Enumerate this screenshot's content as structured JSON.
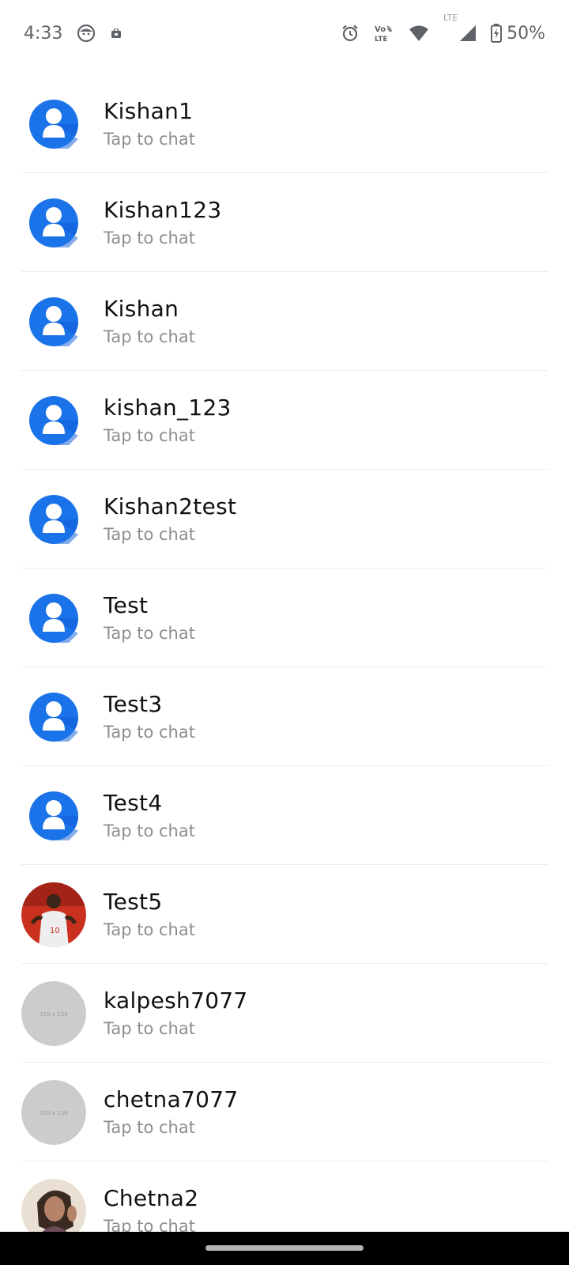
{
  "status_bar": {
    "time": "4:33",
    "battery": "50%",
    "left_icons": [
      "face-icon",
      "notification-icon"
    ],
    "right_icons": [
      "alarm-icon",
      "volte-icon",
      "wifi-icon",
      "lte-icon",
      "signal-icon",
      "battery-icon"
    ],
    "volte_label_top": "Vo",
    "volte_label_bottom": "LTE",
    "lte_label": "LTE"
  },
  "colors": {
    "default_avatar": "#1a73e8",
    "placeholder_avatar": "#cccccc",
    "subtitle": "#8e8e8e",
    "divider": "#ececec"
  },
  "chats": [
    {
      "name": "Kishan1",
      "subtitle": "Tap to chat",
      "avatar": "default-person-icon"
    },
    {
      "name": "Kishan123",
      "subtitle": "Tap to chat",
      "avatar": "default-person-icon"
    },
    {
      "name": "Kishan",
      "subtitle": "Tap to chat",
      "avatar": "default-person-icon"
    },
    {
      "name": "kishan_123",
      "subtitle": "Tap to chat",
      "avatar": "default-person-icon"
    },
    {
      "name": "Kishan2test",
      "subtitle": "Tap to chat",
      "avatar": "default-person-icon"
    },
    {
      "name": "Test",
      "subtitle": "Tap to chat",
      "avatar": "default-person-icon"
    },
    {
      "name": "Test3",
      "subtitle": "Tap to chat",
      "avatar": "default-person-icon"
    },
    {
      "name": "Test4",
      "subtitle": "Tap to chat",
      "avatar": "default-person-icon"
    },
    {
      "name": "Test5",
      "subtitle": "Tap to chat",
      "avatar": "photo-basketball-player"
    },
    {
      "name": "kalpesh7077",
      "subtitle": "Tap to chat",
      "avatar": "placeholder-image",
      "placeholder_label": "150 x 150"
    },
    {
      "name": "chetna7077",
      "subtitle": "Tap to chat",
      "avatar": "placeholder-image",
      "placeholder_label": "150 x 150"
    },
    {
      "name": "Chetna2",
      "subtitle": "Tap to chat",
      "avatar": "photo-woman"
    }
  ]
}
